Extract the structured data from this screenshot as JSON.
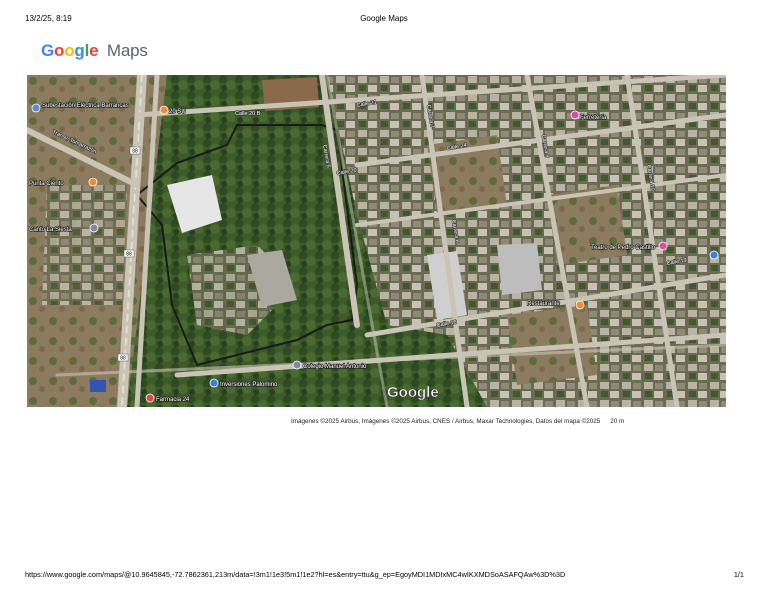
{
  "header": {
    "datetime": "13/2/25, 8:19",
    "title": "Google Maps"
  },
  "logo": {
    "letters": [
      "G",
      "o",
      "o",
      "g",
      "l",
      "e"
    ],
    "product": "Maps"
  },
  "map": {
    "watermark": "Google",
    "pois": [
      {
        "label": "Subestación Eléctrica Barrancas",
        "icon": "substation-icon"
      },
      {
        "label": "Punta Ciento",
        "icon": "food-icon"
      },
      {
        "label": "Canto La Siesta",
        "icon": "church-icon"
      },
      {
        "label": "20 SU",
        "icon": "food-icon"
      },
      {
        "label": "Ferretería",
        "icon": "shop-icon"
      },
      {
        "label": "Teatro de Pedro Castillo",
        "icon": "theater-icon"
      },
      {
        "label": "Colegio Manuel Antonio",
        "icon": "school-icon"
      },
      {
        "label": "Inversiones Palomino",
        "icon": "shop-icon"
      },
      {
        "label": "Farmacia 24",
        "icon": "pharmacy-icon"
      },
      {
        "label": "Restaurante",
        "icon": "food-icon"
      }
    ],
    "streets": [
      "Calle 20 B",
      "Calle 21",
      "Calle 24",
      "Calle 20",
      "Calle 19",
      "Calle 16",
      "Carrera 6",
      "Carrera 7",
      "Carrera 8",
      "Carrera 9",
      "Carrera 10",
      "Transv. Tomarrazón"
    ],
    "road_shields": [
      "88",
      "88",
      "88"
    ]
  },
  "attribution": {
    "text": "Imágenes ©2025 Airbus, Imágenes ©2025 Airbus, CNES / Airbus, Maxar Technologies, Datos del mapa ©2025",
    "scale": "20 m"
  },
  "footer": {
    "url": "https://www.google.com/maps/@10.9645845,-72.7862361,213m/data=!3m1!1e3!5m1!1e2?hl=es&entry=ttu&g_ep=EgoyMDI1MDIxMC4wIKXMDSoASAFQAw%3D%3D",
    "page": "1/1"
  }
}
